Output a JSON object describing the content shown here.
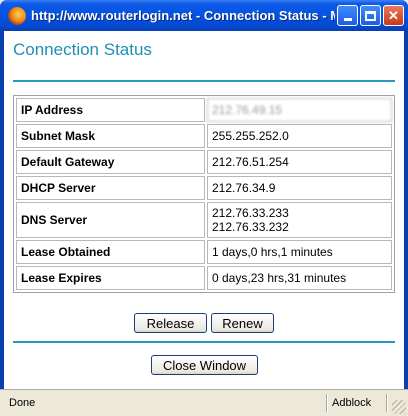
{
  "window": {
    "title": "http://www.routerlogin.net - Connection Status - Mozilla Firefox",
    "icon": "firefox-icon",
    "controls": {
      "minimize": "minimize-icon",
      "maximize": "maximize-icon",
      "close": "✕"
    }
  },
  "page": {
    "heading": "Connection Status",
    "accent_color": "#1f8fb4",
    "rows": [
      {
        "label": "IP Address",
        "value": "212.76.49.15"
      },
      {
        "label": "Subnet Mask",
        "value": "255.255.252.0"
      },
      {
        "label": "Default Gateway",
        "value": "212.76.51.254"
      },
      {
        "label": "DHCP Server",
        "value": "212.76.34.9"
      },
      {
        "label": "DNS Server",
        "value": "212.76.33.233",
        "value2": "212.76.33.232"
      },
      {
        "label": "Lease Obtained",
        "value": "1 days,0 hrs,1 minutes"
      },
      {
        "label": "Lease Expires",
        "value": "0 days,23 hrs,31 minutes"
      }
    ],
    "buttons": {
      "release": "Release",
      "renew": "Renew",
      "close_window": "Close Window"
    }
  },
  "statusbar": {
    "status": "Done",
    "addon": "Adblock"
  }
}
